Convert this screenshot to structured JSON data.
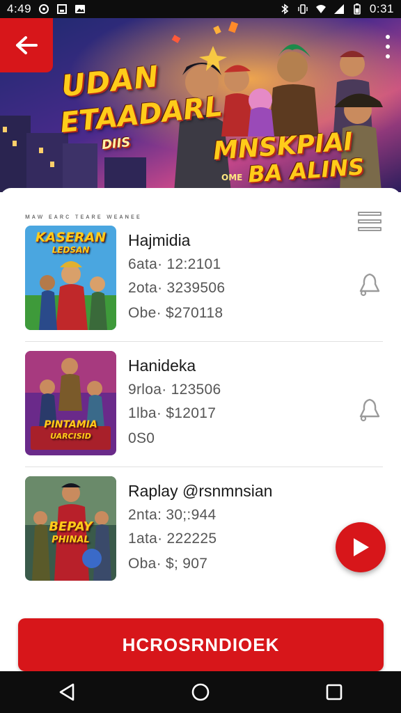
{
  "status_bar": {
    "time": "4:49",
    "clock": "0:31"
  },
  "hero": {
    "title_line1": "UDAN",
    "title_line2": "ETAADARL",
    "subtitle": "DIIS",
    "title_line3": "MNSKPIAI",
    "title_line4": "BA ALINS",
    "small_text": "OME"
  },
  "list": {
    "header_text": "ᴍᴀᴡ ᴇᴀʀᴄ ᴛᴇᴀʀᴇ ᴡᴇᴀɴᴇᴇ",
    "items": [
      {
        "thumb_label_top": "KASERAN",
        "thumb_label_bottom": "LEDSAN",
        "title": "Hajmidia",
        "line1": "6ata· 12:2101",
        "line2": "2ota· 3239506",
        "line3": "Obe· $270118"
      },
      {
        "thumb_label_top": "PINTAMIA",
        "thumb_label_bottom": "UARCISID",
        "title": "Hanideka",
        "line1": "9rloa· 123506",
        "line2": "1lba· $12017",
        "line3": "0S0"
      },
      {
        "thumb_label_top": "BEPAY",
        "thumb_label_bottom": "PHINAL",
        "title": "Raplay @rsnmnsian",
        "line1": "2nta: 30;:944",
        "line2": "1ata· 222225",
        "line3": "Oba· $; 907"
      }
    ]
  },
  "main_button": {
    "label": "HCROSRNDIOEK"
  },
  "colors": {
    "accent": "#d7161a",
    "bars": "#0d0d0d"
  }
}
